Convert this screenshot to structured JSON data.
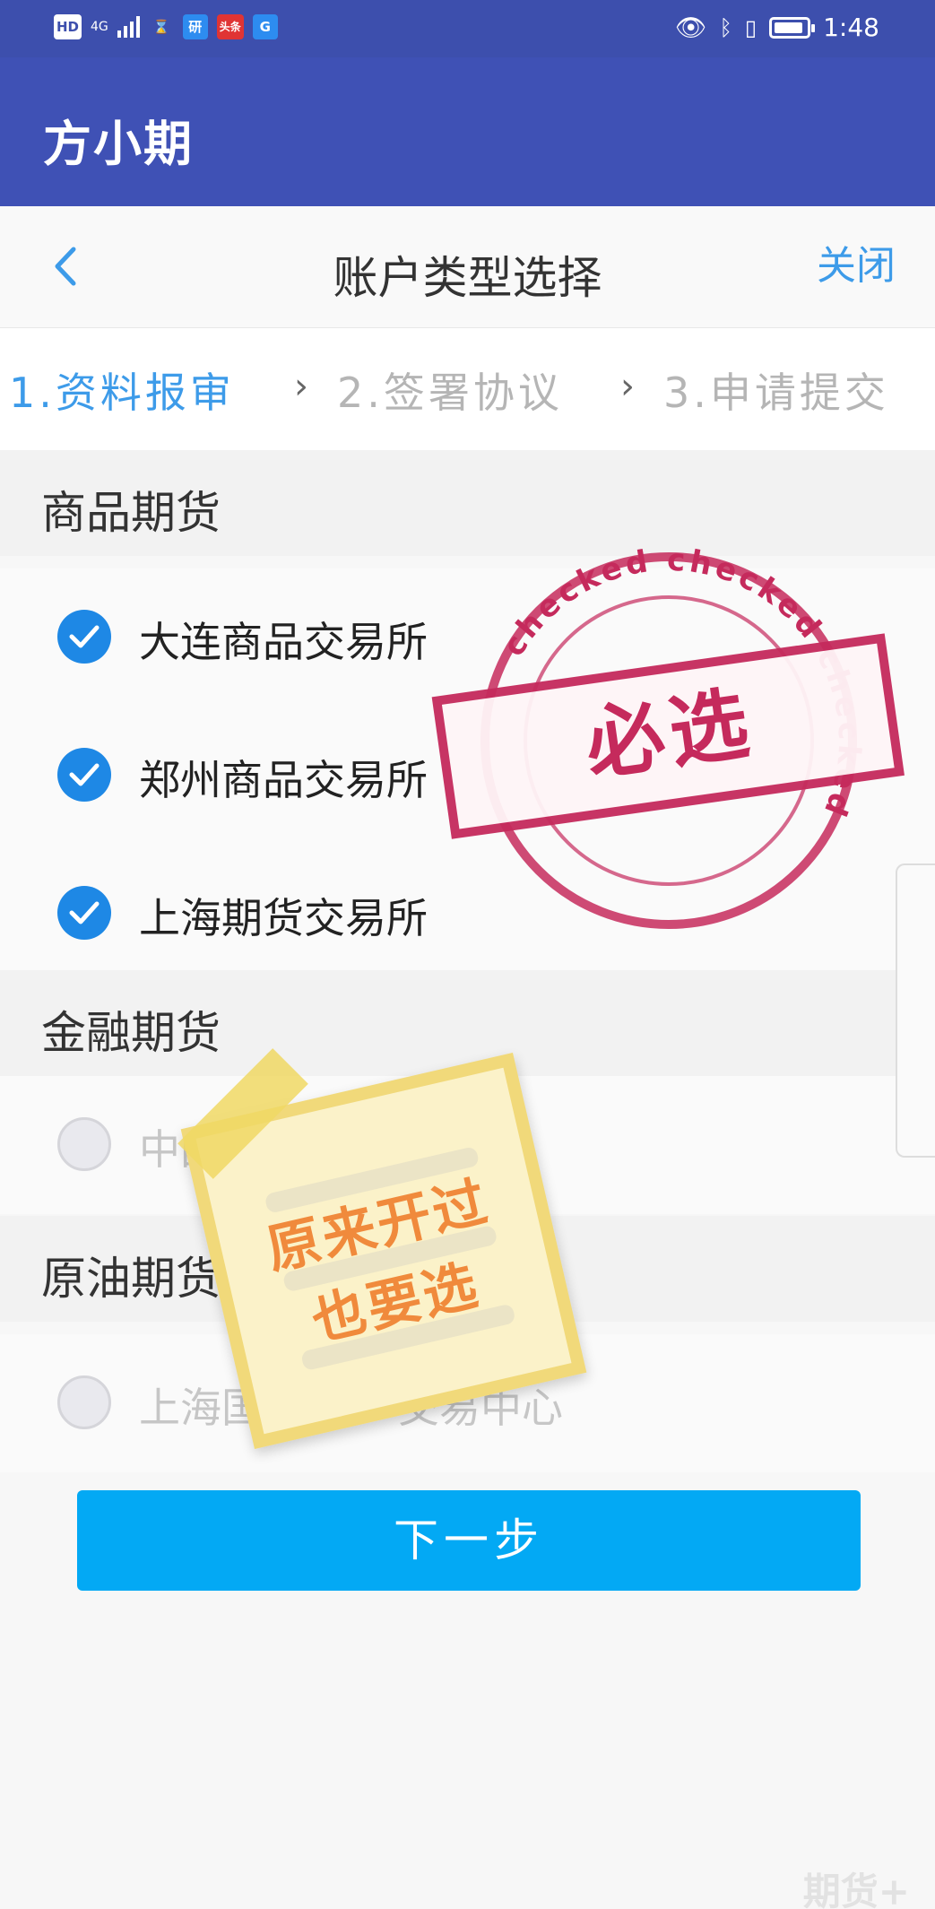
{
  "statusbar": {
    "hd": "HD",
    "network": "4G",
    "app_icon_1": "研",
    "app_icon_2": "头条",
    "app_icon_3": "G",
    "time": "1:48",
    "battery_level": 0.85
  },
  "appbar": {
    "title": "方小期"
  },
  "nav": {
    "title": "账户类型选择",
    "close_label": "关闭"
  },
  "steps": [
    {
      "label": "1.资料报审",
      "active": true
    },
    {
      "label": "2.签署协议",
      "active": false
    },
    {
      "label": "3.申请提交",
      "active": false
    }
  ],
  "sections": {
    "commodity": {
      "title": "商品期货",
      "items": [
        {
          "label": "大连商品交易所",
          "checked": true
        },
        {
          "label": "郑州商品交易所",
          "checked": true
        },
        {
          "label": "上海期货交易所",
          "checked": true
        }
      ]
    },
    "financial": {
      "title": "金融期货",
      "items": [
        {
          "label": "中国",
          "checked": false
        }
      ]
    },
    "crude": {
      "title": "原油期货",
      "items": [
        {
          "label": "上海国",
          "label_tail": "交易中心",
          "checked": false
        }
      ]
    }
  },
  "next_button": {
    "label": "下一步"
  },
  "stamp": {
    "text": "必选",
    "ring_text": "checked checked checked",
    "color": "#c52a5c"
  },
  "sticky_note": {
    "line1": "原来开过",
    "line2": "也要选",
    "color": "#f08a3c"
  },
  "watermark": "期货+",
  "colors": {
    "primary": "#3f51b5",
    "accent": "#1e88e5",
    "button": "#03a9f4",
    "link": "#3d9be9"
  }
}
